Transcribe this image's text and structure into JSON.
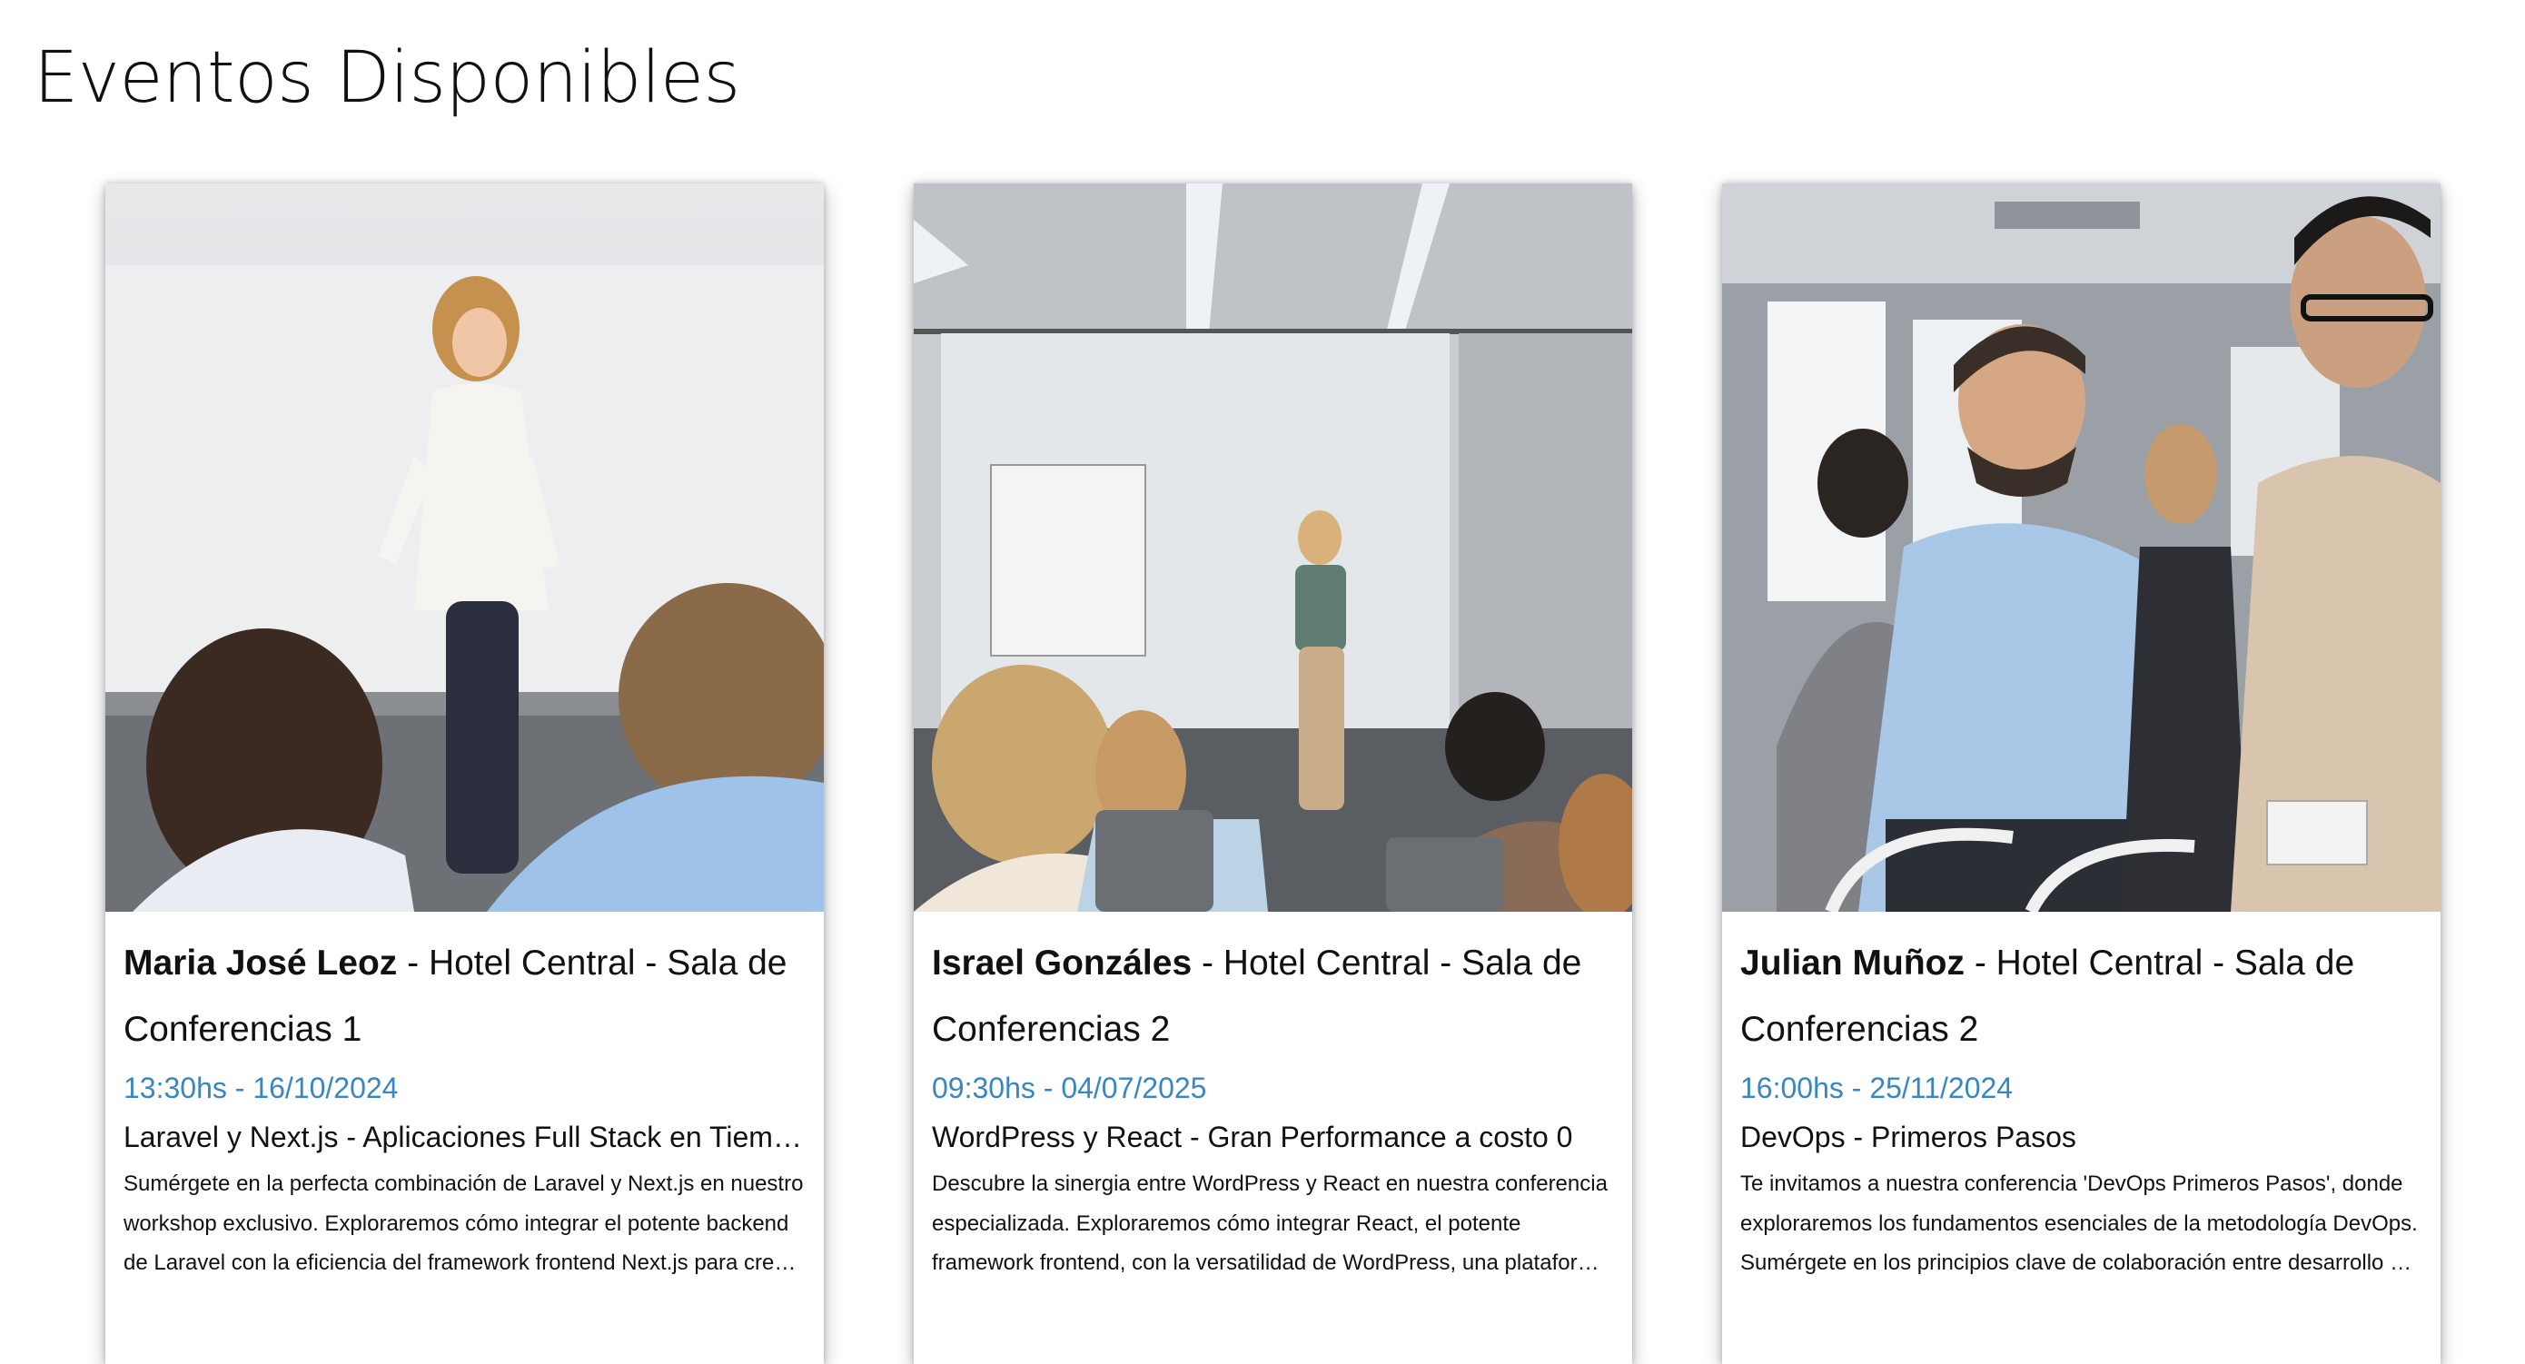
{
  "page": {
    "title": "Eventos Disponibles"
  },
  "colors": {
    "datetime": "#3a86c0",
    "text": "#111111",
    "background": "#ffffff"
  },
  "events": [
    {
      "speaker": "Maria José Leoz",
      "location": " - Hotel Central - Sala de Conferencias 1",
      "datetime": "13:30hs - 16/10/2024",
      "title": "Laravel y Next.js - Aplicaciones Full Stack en Tiempo Real",
      "description": "Sumérgete en la perfecta combinación de Laravel y Next.js en nuestro workshop exclusivo. Exploraremos cómo integrar el potente backend de Laravel con la eficiencia del framework frontend Next.js para crear aplicaciones full stack en tiempo real."
    },
    {
      "speaker": "Israel Gonzáles",
      "location": " - Hotel Central - Sala de Conferencias 2",
      "datetime": "09:30hs - 04/07/2025",
      "title": "WordPress y React - Gran Performance a costo 0",
      "description": "Descubre la sinergia entre WordPress y React en nuestra conferencia especializada. Exploraremos cómo integrar React, el potente framework frontend, con la versatilidad de WordPress, una plataforma de gestión de contenidos."
    },
    {
      "speaker": "Julian Muñoz",
      "location": " - Hotel Central - Sala de Conferencias 2",
      "datetime": "16:00hs - 25/11/2024",
      "title": "DevOps - Primeros Pasos",
      "description": "Te invitamos a nuestra conferencia 'DevOps Primeros Pasos', donde exploraremos los fundamentos esenciales de la metodología DevOps. Sumérgete en los principios clave de colaboración entre desarrollo y operaciones."
    }
  ]
}
